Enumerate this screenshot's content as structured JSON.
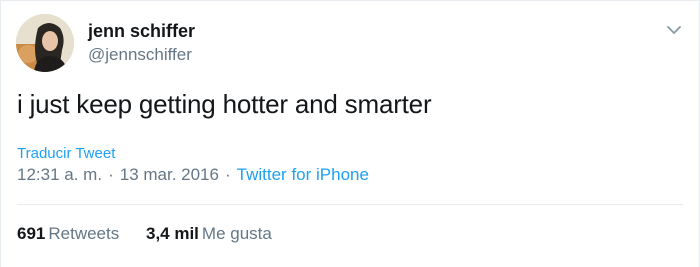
{
  "author": {
    "display_name": "jenn schiffer",
    "handle": "@jennschiffer",
    "avatar_icon": "user-avatar-photo"
  },
  "tweet": {
    "text": "i just keep getting hotter and smarter",
    "translate_label": "Traducir Tweet",
    "time": "12:31 a. m.",
    "date": "13 mar. 2016",
    "separator": "·",
    "source": "Twitter for iPhone"
  },
  "stats": {
    "retweets_count": "691",
    "retweets_label": "Retweets",
    "likes_count": "3,4 mil",
    "likes_label": "Me gusta"
  },
  "menu": {
    "icon": "chevron-down-icon"
  },
  "colors": {
    "link": "#1da1f2",
    "secondary_text": "#657786",
    "primary_text": "#14171a",
    "divider": "#e6ecf0"
  }
}
